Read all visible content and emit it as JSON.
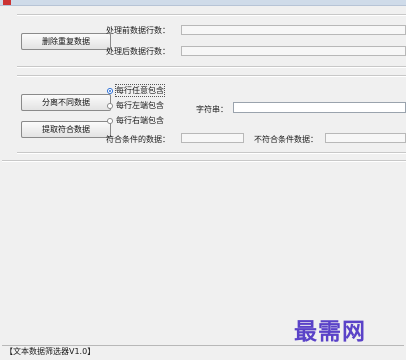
{
  "section1": {
    "delete_button": "删除重复数据",
    "rows_before_label": "处理前数据行数：",
    "rows_after_label": "处理后数据行数：",
    "rows_before_value": "",
    "rows_after_value": ""
  },
  "section2": {
    "split_button": "分离不同数据",
    "extract_button": "提取符合数据",
    "radio_options": [
      "每行任意包含",
      "每行左端包含",
      "每行右端包含"
    ],
    "selected_radio": 0,
    "string_label": "字符串：",
    "string_value": "",
    "matching_label": "符合条件的数据：",
    "nonmatching_label": "不符合条件数据：",
    "matching_value": "",
    "nonmatching_value": ""
  },
  "status_bar": {
    "text": "【文本数据筛选器V1.0】"
  },
  "watermark": {
    "text": "最需网"
  },
  "colors": {
    "accent": "#2b6fd6",
    "watermark": "#5a42c8"
  }
}
